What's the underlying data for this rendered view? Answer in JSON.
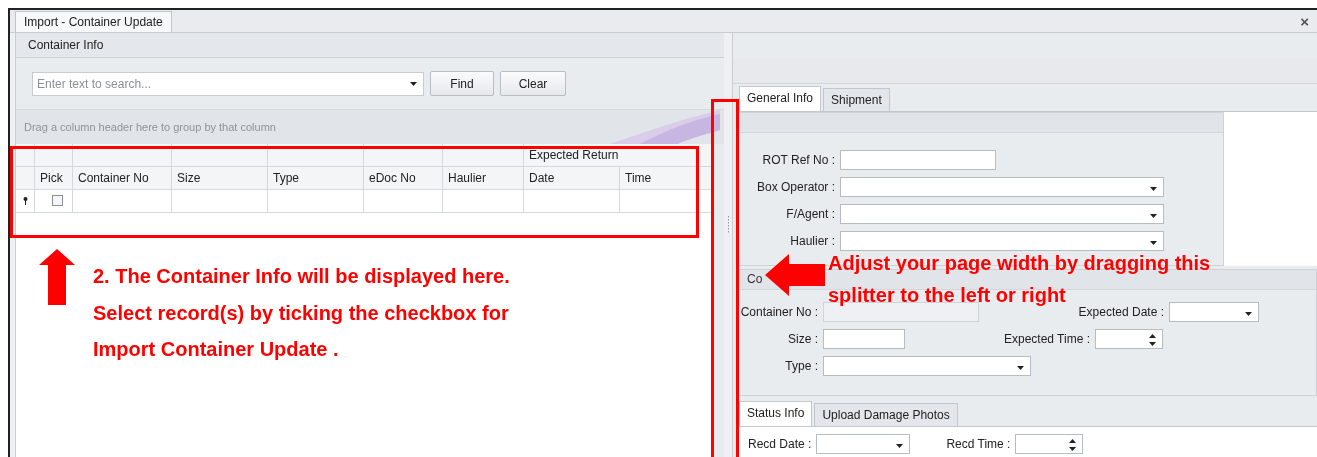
{
  "window": {
    "tab_title": "Import - Container Update",
    "close": "×"
  },
  "left_panel": {
    "title": "Container Info",
    "search": {
      "placeholder": "Enter text to search..."
    },
    "buttons": [
      "Find",
      "Clear"
    ],
    "group_hint": "Drag a column header here to group by that column",
    "grid": {
      "band": {
        "label": "Expected Return"
      },
      "columns": [
        "Pick",
        "Container No",
        "Size",
        "Type",
        "eDoc No",
        "Haulier",
        "Date",
        "Time"
      ],
      "rows": [
        {
          "pick": false
        }
      ]
    }
  },
  "right_panel": {
    "tabs": [
      {
        "label": "General Info",
        "selected": true
      },
      {
        "label": "Shipment",
        "selected": false
      }
    ],
    "fields": [
      {
        "label": "ROT Ref No :",
        "kind": "text"
      },
      {
        "label": "Box Operator :",
        "kind": "combo"
      },
      {
        "label": "F/Agent :",
        "kind": "combo"
      },
      {
        "label": "Haulier :",
        "kind": "combo"
      }
    ],
    "container_group": {
      "title": "Co",
      "rows": [
        [
          {
            "label": "Container No :",
            "kind": "text",
            "disabled": true
          },
          {
            "label": "Expected Date :",
            "kind": "combo",
            "disabled": false
          }
        ],
        [
          {
            "label": "Size :",
            "kind": "text",
            "disabled": false
          },
          {
            "label": "Expected Time :",
            "kind": "spin",
            "disabled": false
          }
        ],
        [
          {
            "label": "Type :",
            "kind": "combo",
            "disabled": false
          }
        ]
      ]
    },
    "status_tabs": [
      {
        "label": "Status Info",
        "selected": true
      },
      {
        "label": "Upload Damage Photos",
        "selected": false
      }
    ],
    "status_fields": [
      {
        "label": "Recd Date :",
        "kind": "combo"
      },
      {
        "label": "Recd Time :",
        "kind": "spin"
      }
    ]
  },
  "annotations": [
    {
      "kind": "grid_note",
      "lines": [
        "2.  The Container Info will be displayed here.",
        "Select record(s) by ticking the checkbox for",
        "Import Container Update ."
      ]
    },
    {
      "kind": "splitter_note",
      "lines": [
        "Adjust your page width by dragging this",
        "splitter to the left or right"
      ]
    }
  ]
}
